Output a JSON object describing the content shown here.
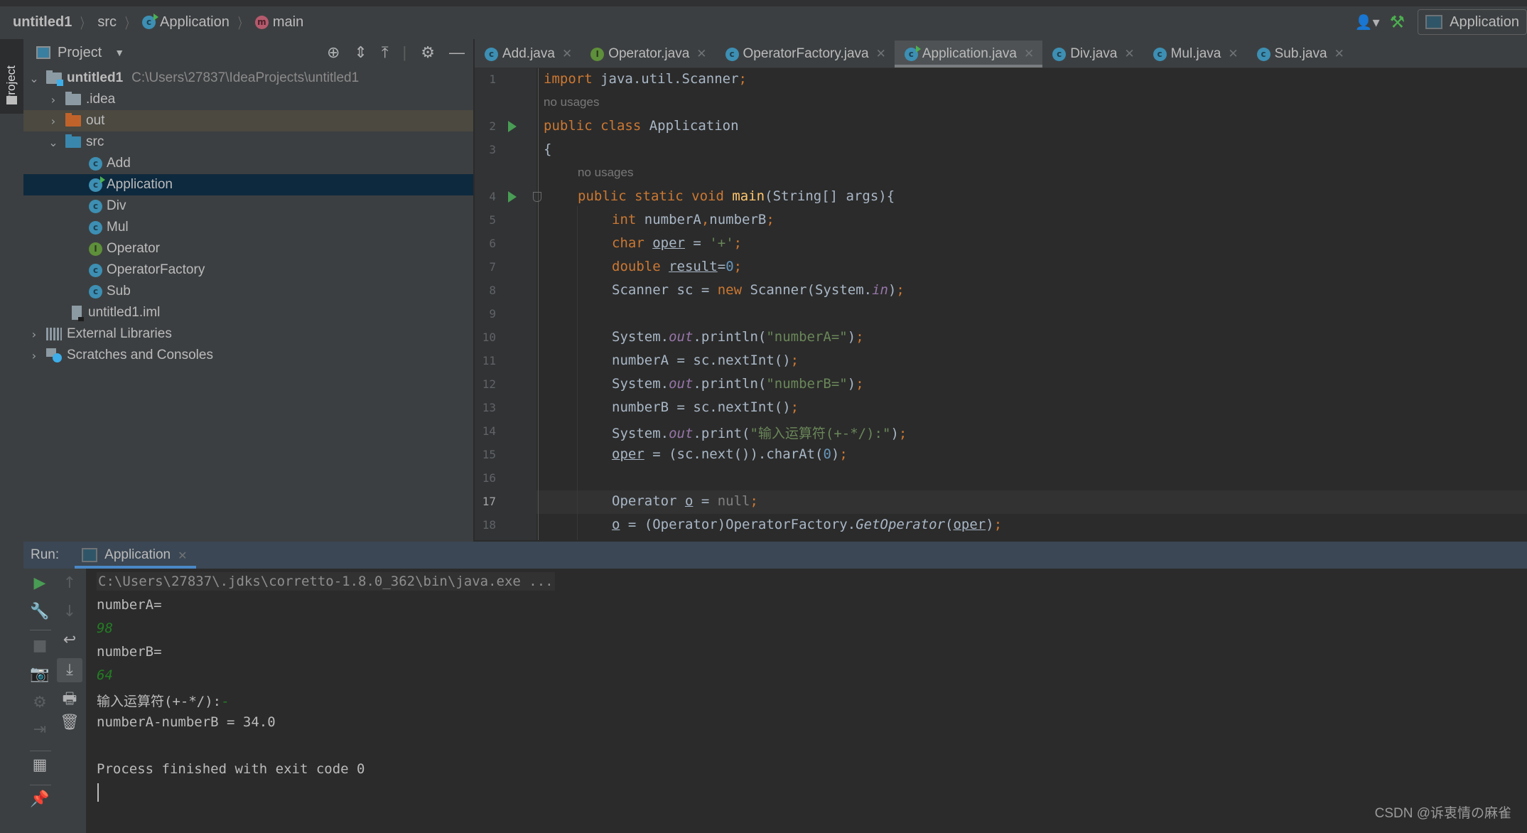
{
  "breadcrumb": {
    "project": "untitled1",
    "folder": "src",
    "class": "Application",
    "method": "main"
  },
  "toolbar": {
    "vcs_icon": "user-icon",
    "build_icon": "hammer-icon",
    "run_config": "Application"
  },
  "sidebar_tab": "Project",
  "project_panel": {
    "title": "Project",
    "tools": [
      "locate-icon",
      "expand-all-icon",
      "collapse-all-icon",
      "gear-icon",
      "minimize-icon"
    ],
    "tree": [
      {
        "label": "untitled1",
        "path": "C:\\Users\\27837\\IdeaProjects\\untitled1",
        "type": "root",
        "expanded": true
      },
      {
        "label": ".idea",
        "type": "folder",
        "expanded": false
      },
      {
        "label": "out",
        "type": "folder-excluded",
        "expanded": false
      },
      {
        "label": "src",
        "type": "folder-source",
        "expanded": true
      },
      {
        "label": "Add",
        "type": "class"
      },
      {
        "label": "Application",
        "type": "class-runnable",
        "selected": true
      },
      {
        "label": "Div",
        "type": "class"
      },
      {
        "label": "Mul",
        "type": "class"
      },
      {
        "label": "Operator",
        "type": "interface"
      },
      {
        "label": "OperatorFactory",
        "type": "class"
      },
      {
        "label": "Sub",
        "type": "class"
      },
      {
        "label": "untitled1.iml",
        "type": "module-file"
      },
      {
        "label": "External Libraries",
        "type": "libraries",
        "expanded": false
      },
      {
        "label": "Scratches and Consoles",
        "type": "scratches",
        "expanded": false
      }
    ]
  },
  "editor": {
    "tabs": [
      {
        "label": "Add.java",
        "icon": "class-icon"
      },
      {
        "label": "Operator.java",
        "icon": "interface-icon"
      },
      {
        "label": "OperatorFactory.java",
        "icon": "class-icon"
      },
      {
        "label": "Application.java",
        "icon": "runnable-class-icon",
        "active": true
      },
      {
        "label": "Div.java",
        "icon": "class-icon"
      },
      {
        "label": "Mul.java",
        "icon": "class-icon"
      },
      {
        "label": "Sub.java",
        "icon": "class-icon"
      }
    ],
    "hint_no_usages": "no usages",
    "current_line": 17,
    "lines": {
      "1": [
        "import",
        " java.util.Scanner",
        ";"
      ],
      "2": [
        "public class",
        " Application"
      ],
      "3": "{",
      "4": [
        "public static void",
        " ",
        "main",
        "(String[] args){"
      ],
      "5": [
        "int",
        " numberA",
        ",",
        "numberB",
        ";"
      ],
      "6": [
        "char",
        " ",
        "oper",
        " = ",
        "'+'",
        ";"
      ],
      "7": [
        "double",
        " ",
        "result",
        "=",
        "0",
        ";"
      ],
      "8": [
        "Scanner sc = ",
        "new",
        " Scanner(System.",
        "in",
        ")",
        ";"
      ],
      "10": [
        "System.",
        "out",
        ".println(",
        "\"numberA=\"",
        ")",
        ";"
      ],
      "11": [
        "numberA = sc.nextInt()",
        ";"
      ],
      "12": [
        "System.",
        "out",
        ".println(",
        "\"numberB=\"",
        ")",
        ";"
      ],
      "13": [
        "numberB = sc.nextInt()",
        ";"
      ],
      "14": [
        "System.",
        "out",
        ".print(",
        "\"输入运算符(+-*/):\"",
        ")",
        ";"
      ],
      "15": [
        "oper",
        " = (sc.next()).charAt(",
        "0",
        ")",
        ";"
      ],
      "17": [
        "Operator ",
        "o",
        " = ",
        "null",
        ";"
      ],
      "18": [
        "o",
        " = (Operator)OperatorFactory.",
        "GetOperator",
        "(",
        "oper",
        ")",
        ";"
      ]
    }
  },
  "run_panel": {
    "label": "Run:",
    "tab": "Application",
    "console": {
      "command": "C:\\Users\\27837\\.jdks\\corretto-1.8.0_362\\bin\\java.exe ...",
      "out1": "numberA=",
      "in1": "98",
      "out2": "numberB=",
      "in2": "64",
      "prompt": "输入运算符(+-*/):",
      "in3": "-",
      "result": "numberA-numberB = 34.0",
      "exit": "Process finished with exit code 0"
    }
  },
  "watermark": "CSDN @诉衷情の麻雀"
}
